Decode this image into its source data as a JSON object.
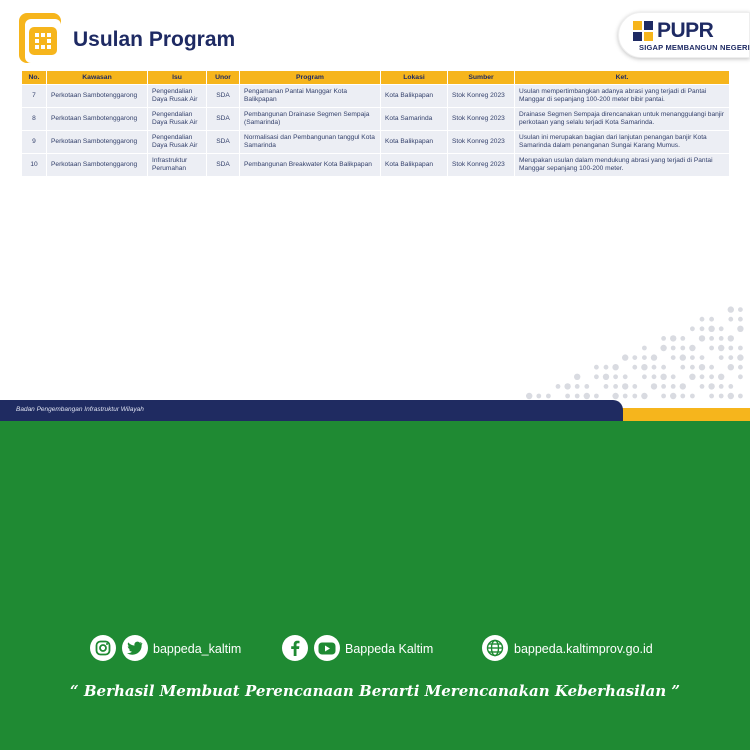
{
  "slide": {
    "title": "Usulan Program",
    "footer_text": "Badan Pengembangan Infrastruktur Wilayah",
    "logo": {
      "icon": "grid-dots-icon",
      "color": "#f6b51c"
    },
    "pupr": {
      "name": "PUPR",
      "tagline": "SIGAP MEMBANGUN NEGERI"
    }
  },
  "table": {
    "headers": [
      "No.",
      "Kawasan",
      "Isu",
      "Unor",
      "Program",
      "Lokasi",
      "Sumber",
      "Ket."
    ],
    "rows": [
      [
        "7",
        "Perkotaan Sambotenggarong",
        "Pengendalian Daya Rusak Air",
        "SDA",
        "Pengamanan Pantai Manggar Kota Balikpapan",
        "Kota Balikpapan",
        "Stok Konreg 2023",
        "Usulan mempertimbangkan adanya abrasi yang terjadi di Pantai Manggar di sepanjang 100-200 meter bibir pantai."
      ],
      [
        "8",
        "Perkotaan Sambotenggarong",
        "Pengendalian Daya Rusak Air",
        "SDA",
        "Pembangunan Drainase Segmen Sempaja (Samarinda)",
        "Kota Samarinda",
        "Stok Konreg 2023",
        "Drainase Segmen Sempaja direncanakan untuk menanggulangi banjir perkotaan yang selalu terjadi Kota Samarinda."
      ],
      [
        "9",
        "Perkotaan Sambotenggarong",
        "Pengendalian Daya Rusak Air",
        "SDA",
        "Normalisasi dan Pembangunan tanggul Kota Samarinda",
        "Kota Balikpapan",
        "Stok Konreg 2023",
        "Usulan ini merupakan bagian dari lanjutan penangan banjir Kota Samarinda dalam penanganan Sungai Karang Mumus."
      ],
      [
        "10",
        "Perkotaan Sambotenggarong",
        "Infrastruktur Perumahan",
        "SDA",
        "Pembangunan Breakwater Kota Balikpapan",
        "Kota Balikpapan",
        "Stok Konreg 2023",
        "Merupakan usulan dalam mendukung abrasi yang terjadi di Pantai Manggar sepanjang 100-200 meter."
      ]
    ]
  },
  "social": {
    "instagram_icon": "instagram-icon",
    "twitter_icon": "twitter-icon",
    "handle": "bappeda_kaltim",
    "facebook_icon": "facebook-icon",
    "youtube_icon": "youtube-icon",
    "page": "Bappeda Kaltim",
    "globe_icon": "globe-icon",
    "website": "bappeda.kaltimprov.go.id"
  },
  "quote": "“ Berhasil  Membuat Perencanaan Berarti Merencanakan Keberhasilan ”",
  "colors": {
    "green": "#1f8a33",
    "navy": "#1f2b61",
    "yellow": "#f6b51c"
  }
}
